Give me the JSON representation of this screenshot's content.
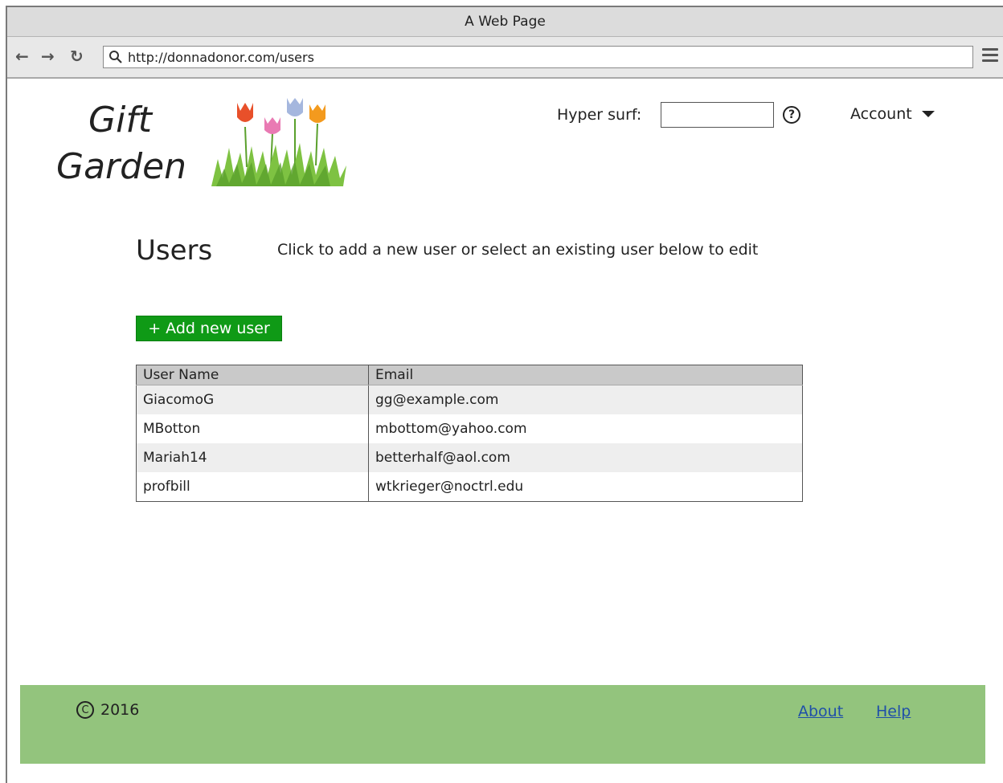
{
  "window": {
    "title": "A Web Page"
  },
  "browser": {
    "url": "http://donnadonor.com/users",
    "back_icon": "back-arrow-icon",
    "forward_icon": "forward-arrow-icon",
    "reload_icon": "reload-icon",
    "search_icon": "magnifier-icon",
    "menu_icon": "hamburger-menu-icon"
  },
  "header": {
    "logo_line1": "Gift",
    "logo_line2": "Garden",
    "search_label": "Hyper surf:",
    "search_value": "",
    "help_glyph": "?",
    "account_label": "Account"
  },
  "main": {
    "title": "Users",
    "hint": "Click to add a new user or select an existing user below to edit",
    "add_button": "+ Add new user",
    "add_button_color": "#0f9a16",
    "table": {
      "headers": [
        "User Name",
        "Email"
      ],
      "rows": [
        {
          "name": "GiacomoG",
          "email": "gg@example.com"
        },
        {
          "name": "MBotton",
          "email": "mbottom@yahoo.com"
        },
        {
          "name": "Mariah14",
          "email": "betterhalf@aol.com"
        },
        {
          "name": "profbill",
          "email": "wtkrieger@noctrl.edu"
        }
      ]
    }
  },
  "footer": {
    "copyright_year": "2016",
    "links": [
      "About",
      "Help"
    ],
    "background_color": "#93c47d"
  }
}
